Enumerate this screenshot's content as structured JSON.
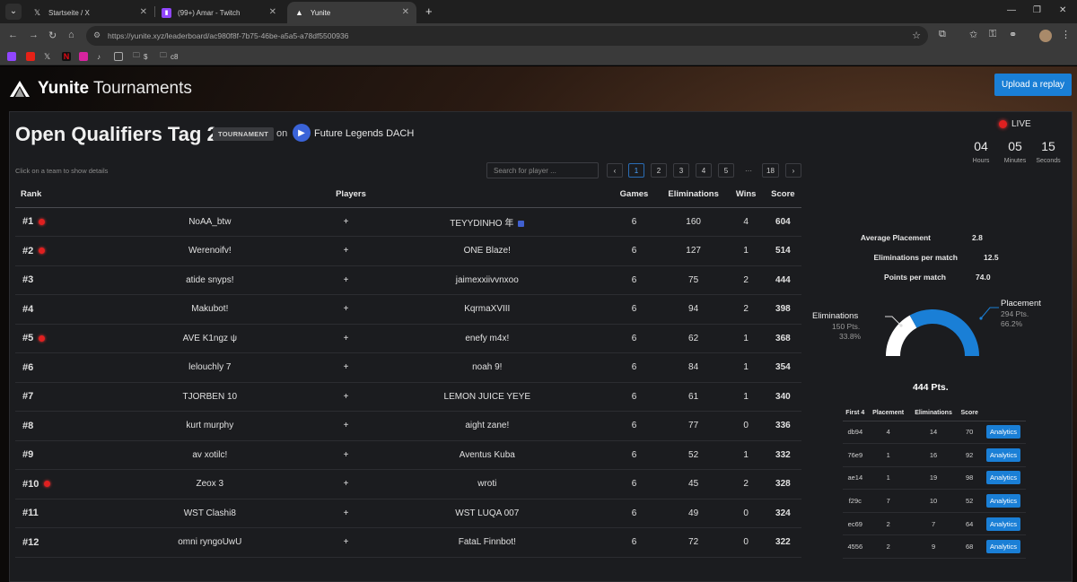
{
  "browser": {
    "tabs": [
      {
        "title": "Startseite / X",
        "icon": "x-logo-icon"
      },
      {
        "title": "(99+) Amar - Twitch",
        "icon": "twitch-icon"
      },
      {
        "title": "Yunite",
        "icon": "yunite-icon"
      }
    ],
    "url": "https://yunite.xyz/leaderboard/ac980f8f-7b75-46be-a5a5-a78df5500936",
    "bookmarks": [
      "$",
      "c8"
    ]
  },
  "header": {
    "brand": "Yunite",
    "brand_suffix": "Tournaments",
    "upload_label": "Upload a replay"
  },
  "tournament": {
    "title": "Open Qualifiers Tag 2",
    "badge": "TOURNAMENT",
    "on": "on",
    "org": "Future Legends DACH",
    "hint": "Click on a team to show details",
    "search_placeholder": "Search for player ...",
    "pages": [
      "‹",
      "1",
      "2",
      "3",
      "4",
      "5",
      "···",
      "18",
      "›"
    ]
  },
  "leaderboard": {
    "columns": {
      "rank": "Rank",
      "players": "Players",
      "games": "Games",
      "eliminations": "Eliminations",
      "wins": "Wins",
      "score": "Score"
    },
    "rows": [
      {
        "rank": "#1",
        "live": true,
        "p1": "NoAA_btw",
        "sep": "+",
        "p2": "TEYYDINHO 年",
        "p2flag": true,
        "games": "6",
        "elims": "160",
        "wins": "4",
        "score": "604"
      },
      {
        "rank": "#2",
        "live": true,
        "p1": "Werenoifv!",
        "sep": "+",
        "p2": "ONE Blaze!",
        "games": "6",
        "elims": "127",
        "wins": "1",
        "score": "514"
      },
      {
        "rank": "#3",
        "live": false,
        "p1": "atide snyps!",
        "sep": "+",
        "p2": "jaimexxiivvnxoo",
        "games": "6",
        "elims": "75",
        "wins": "2",
        "score": "444"
      },
      {
        "rank": "#4",
        "live": false,
        "p1": "Makubot!",
        "sep": "+",
        "p2": "KqrmaXVIII",
        "games": "6",
        "elims": "94",
        "wins": "2",
        "score": "398"
      },
      {
        "rank": "#5",
        "live": true,
        "p1": "AVE K1ngz ψ",
        "sep": "+",
        "p2": "enefy m4x!",
        "games": "6",
        "elims": "62",
        "wins": "1",
        "score": "368"
      },
      {
        "rank": "#6",
        "live": false,
        "p1": "lelouchly 7",
        "sep": "+",
        "p2": "noah 9!",
        "games": "6",
        "elims": "84",
        "wins": "1",
        "score": "354"
      },
      {
        "rank": "#7",
        "live": false,
        "p1": "TJORBEN 10",
        "sep": "+",
        "p2": "LEMON JUICE YEYE",
        "games": "6",
        "elims": "61",
        "wins": "1",
        "score": "340"
      },
      {
        "rank": "#8",
        "live": false,
        "p1": "kurt murphy",
        "sep": "+",
        "p2": "aight zane!",
        "games": "6",
        "elims": "77",
        "wins": "0",
        "score": "336"
      },
      {
        "rank": "#9",
        "live": false,
        "p1": "av xotilc!",
        "sep": "+",
        "p2": "Aventus Kuba",
        "games": "6",
        "elims": "52",
        "wins": "1",
        "score": "332"
      },
      {
        "rank": "#10",
        "live": true,
        "p1": "Zeox 3",
        "sep": "+",
        "p2": "wroti",
        "games": "6",
        "elims": "45",
        "wins": "2",
        "score": "328"
      },
      {
        "rank": "#11",
        "live": false,
        "p1": "WST Clashi8",
        "sep": "+",
        "p2": "WST LUQA 007",
        "games": "6",
        "elims": "49",
        "wins": "0",
        "score": "324"
      },
      {
        "rank": "#12",
        "live": false,
        "p1": "omni ryngoUwU",
        "sep": "+",
        "p2": "FataL Finnbot!",
        "games": "6",
        "elims": "72",
        "wins": "0",
        "score": "322"
      }
    ]
  },
  "countdown": {
    "live_label": "LIVE",
    "hours": "04",
    "hours_label": "Hours",
    "minutes": "05",
    "minutes_label": "Minutes",
    "seconds": "15",
    "seconds_label": "Seconds"
  },
  "stats": {
    "avg_placement_label": "Average Placement",
    "avg_placement": "2.8",
    "elims_per_match_label": "Eliminations per match",
    "elims_per_match": "12.5",
    "points_per_match_label": "Points per match",
    "points_per_match": "74.0"
  },
  "breakdown": {
    "elims_label": "Eliminations",
    "elims_pts": "150 Pts.",
    "elims_pct": "33.8%",
    "placement_label": "Placement",
    "placement_pts": "294 Pts.",
    "placement_pct": "66.2%",
    "total": "444 Pts.",
    "placement_fraction": 0.662,
    "colors": {
      "placement": "#1a7fd6",
      "eliminations": "#ffffff"
    }
  },
  "matches": {
    "columns": {
      "first": "First 4",
      "placement": "Placement",
      "elims": "Eliminations",
      "score": "Score"
    },
    "button_label": "Analytics",
    "rows": [
      {
        "id": "db94",
        "placement": "4",
        "elims": "14",
        "score": "70"
      },
      {
        "id": "76e9",
        "placement": "1",
        "elims": "16",
        "score": "92"
      },
      {
        "id": "ae14",
        "placement": "1",
        "elims": "19",
        "score": "98"
      },
      {
        "id": "f29c",
        "placement": "7",
        "elims": "10",
        "score": "52"
      },
      {
        "id": "ec69",
        "placement": "2",
        "elims": "7",
        "score": "64"
      },
      {
        "id": "4556",
        "placement": "2",
        "elims": "9",
        "score": "68"
      }
    ]
  }
}
